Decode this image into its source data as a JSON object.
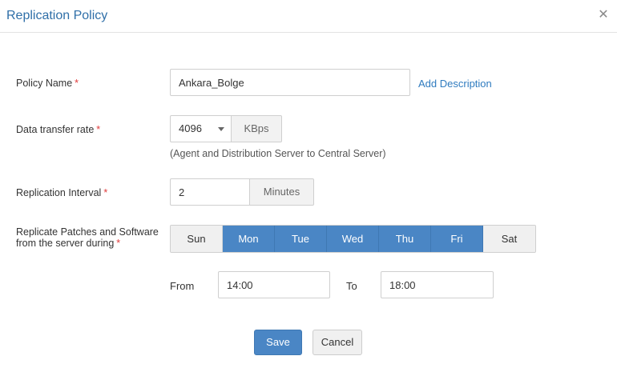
{
  "dialog": {
    "title": "Replication Policy",
    "close_icon": "close-icon"
  },
  "policy_name": {
    "label": "Policy Name",
    "value": "Ankara_Bolge",
    "add_description": "Add Description"
  },
  "transfer_rate": {
    "label": "Data transfer rate",
    "value": "4096",
    "unit": "KBps",
    "note": "(Agent and Distribution Server to Central Server)"
  },
  "interval": {
    "label": "Replication Interval",
    "value": "2",
    "unit": "Minutes"
  },
  "schedule": {
    "label_line1": "Replicate Patches and Software",
    "label_line2": "from the server during",
    "days": [
      {
        "label": "Sun",
        "selected": false
      },
      {
        "label": "Mon",
        "selected": true
      },
      {
        "label": "Tue",
        "selected": true
      },
      {
        "label": "Wed",
        "selected": true
      },
      {
        "label": "Thu",
        "selected": true
      },
      {
        "label": "Fri",
        "selected": true
      },
      {
        "label": "Sat",
        "selected": false
      }
    ],
    "from_label": "From",
    "from_value": "14:00",
    "to_label": "To",
    "to_value": "18:00"
  },
  "required_mark": "*",
  "buttons": {
    "save": "Save",
    "cancel": "Cancel"
  },
  "colors": {
    "accent": "#4a86c5",
    "title": "#2f6fa8",
    "required": "#e03b3b"
  }
}
